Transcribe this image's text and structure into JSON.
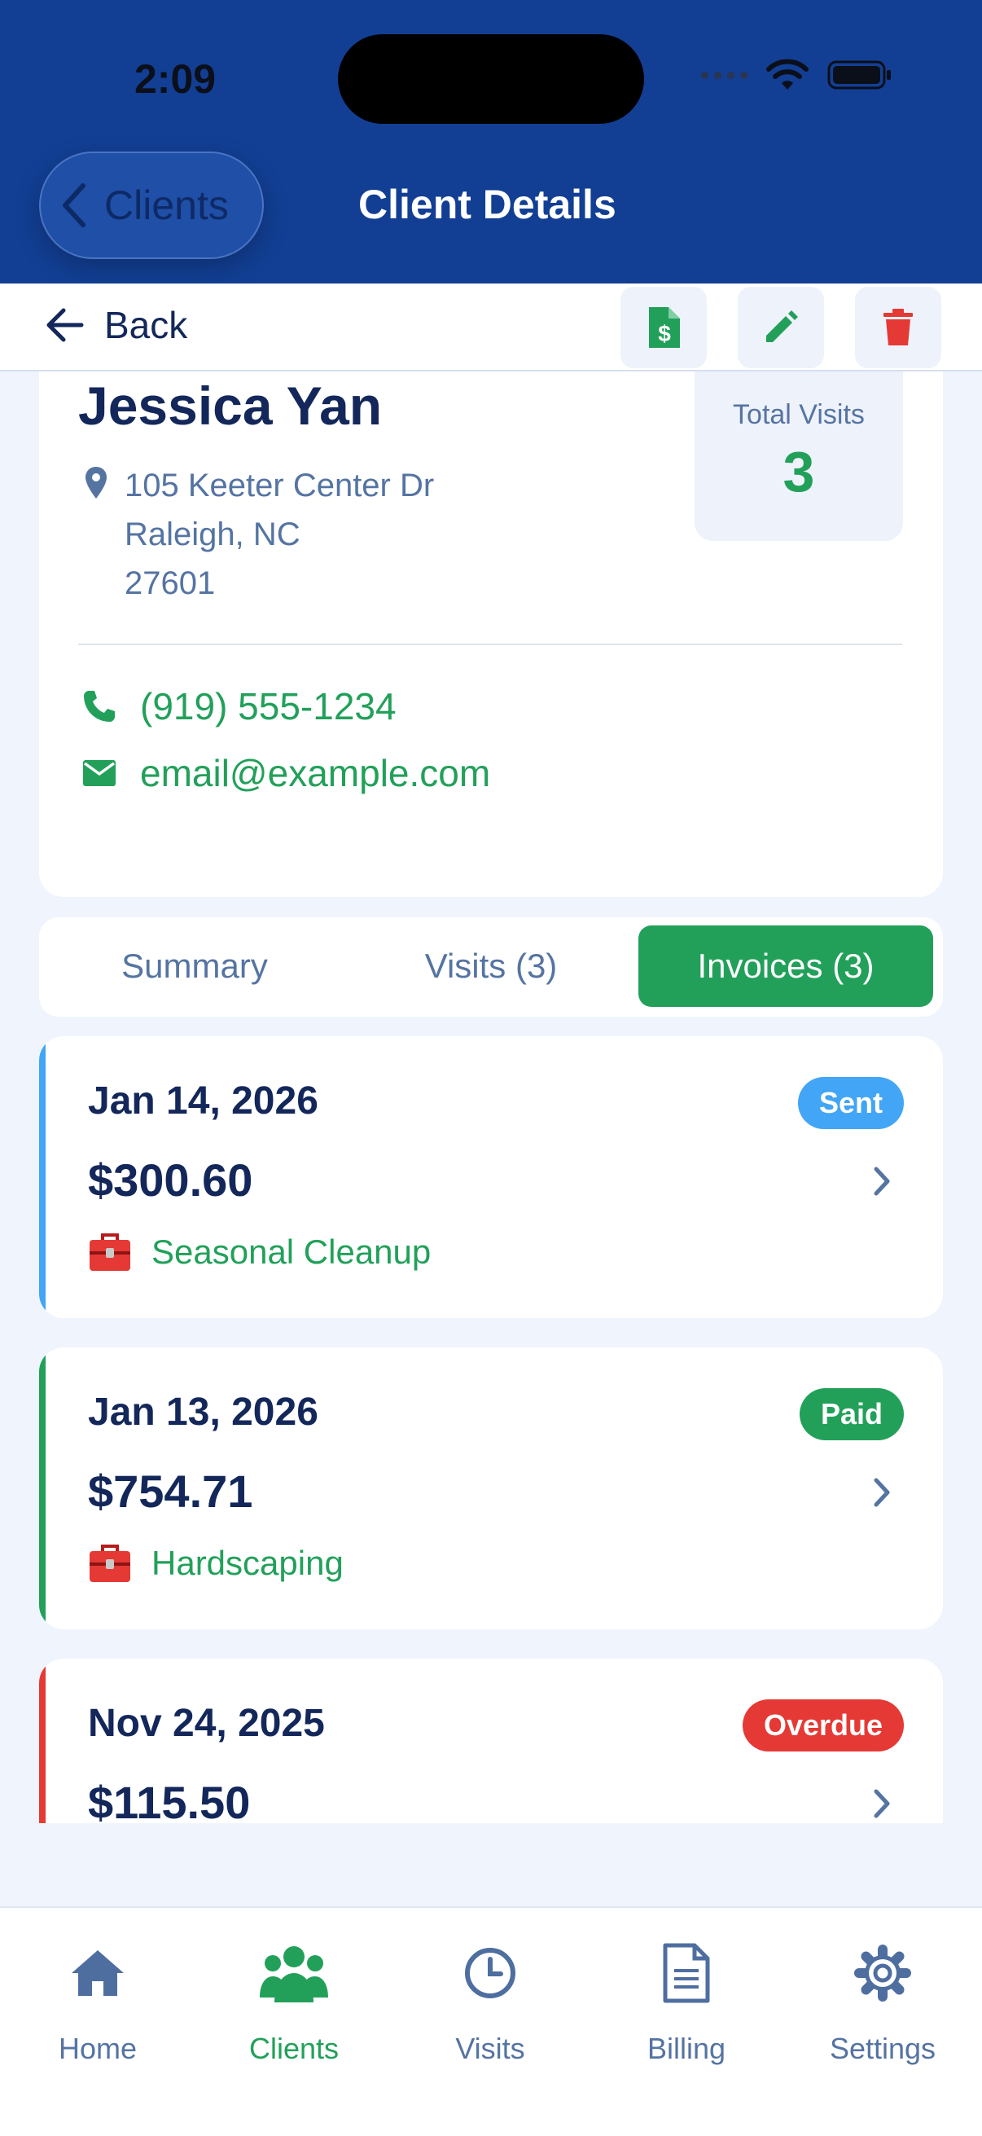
{
  "status_bar": {
    "time": "2:09"
  },
  "header": {
    "back_label": "Clients",
    "title": "Client Details"
  },
  "toolbar": {
    "back_label": "Back",
    "actions": [
      "invoice-icon",
      "pencil-icon",
      "trash-icon"
    ],
    "colors": {
      "invoice": "#22a05a",
      "edit": "#22a05a",
      "delete": "#e53935"
    }
  },
  "client": {
    "name": "Jessica Yan",
    "address": [
      "105 Keeter Center Dr",
      "Raleigh, NC",
      "27601"
    ],
    "total_visits_label": "Total Visits",
    "total_visits": "3",
    "phone": "(919) 555-1234",
    "email": "email@example.com"
  },
  "tabs": [
    {
      "label": "Summary",
      "active": false
    },
    {
      "label": "Visits (3)",
      "active": false
    },
    {
      "label": "Invoices (3)",
      "active": true
    }
  ],
  "invoices": [
    {
      "date": "Jan 14, 2026",
      "amount": "$300.60",
      "status": "Sent",
      "status_color": "#42a5f5",
      "service": "Seasonal Cleanup"
    },
    {
      "date": "Jan 13, 2026",
      "amount": "$754.71",
      "status": "Paid",
      "status_color": "#22a05a",
      "service": "Hardscaping"
    },
    {
      "date": "Nov 24, 2025",
      "amount": "$115.50",
      "status": "Overdue",
      "status_color": "#e53935",
      "service": ""
    }
  ],
  "nav": [
    {
      "label": "Home",
      "icon": "home-icon",
      "active": false
    },
    {
      "label": "Clients",
      "icon": "users-icon",
      "active": true
    },
    {
      "label": "Visits",
      "icon": "clock-icon",
      "active": false
    },
    {
      "label": "Billing",
      "icon": "document-icon",
      "active": false
    },
    {
      "label": "Settings",
      "icon": "gear-icon",
      "active": false
    }
  ],
  "colors": {
    "primary": "#123f94",
    "accent": "#22a05a",
    "text": "#13275a",
    "muted": "#5574a2"
  }
}
